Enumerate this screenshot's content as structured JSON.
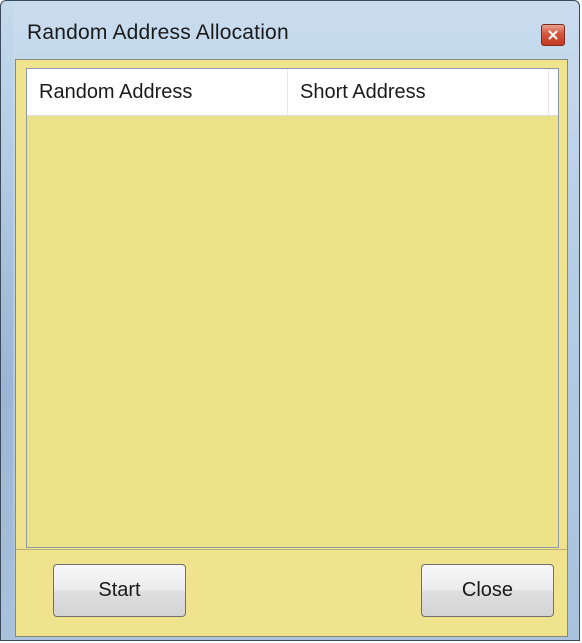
{
  "window": {
    "title": "Random Address Allocation",
    "close_glyph": "x"
  },
  "list": {
    "columns": [
      "Random Address",
      "Short Address"
    ],
    "rows": []
  },
  "buttons": {
    "start_label": "Start",
    "close_label": "Close"
  },
  "colors": {
    "client_background": "#efe38d",
    "list_background": "#ece388",
    "close_button": "#c23b22"
  }
}
